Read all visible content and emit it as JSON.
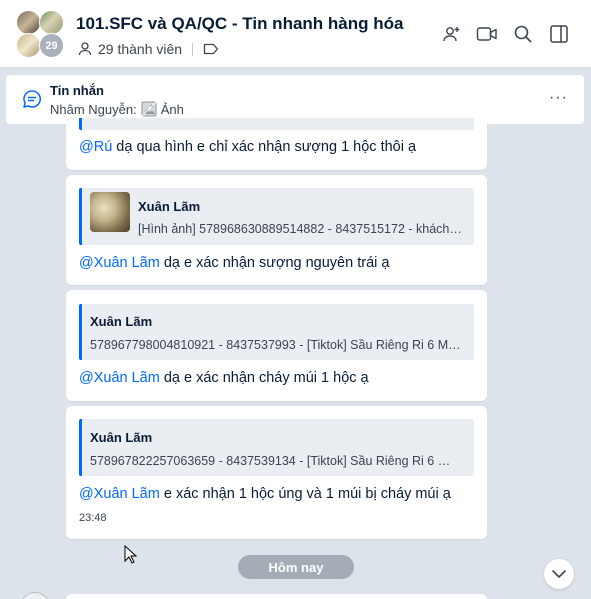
{
  "header": {
    "title": "101.SFC và QA/QC - Tin nhanh hàng hóa",
    "members": "29 thành viên",
    "member_badge": "29",
    "icons": [
      "user-group-icon",
      "tag-icon",
      "add-member-icon",
      "video-call-icon",
      "search-icon",
      "sidebar-toggle-icon"
    ]
  },
  "pinned": {
    "title": "Tin nhắn",
    "sender": "Nhâm Nguyễn:",
    "content": "Ảnh",
    "more": "···"
  },
  "messages": [
    {
      "mention": "@Rú",
      "text": " dạ qua hình e chỉ xác nhận sượng 1 hộc thôi ạ"
    },
    {
      "quote_name": "Xuân Lãm",
      "quote_text": "[Hình ảnh] 578968630889514882 - 8437515172 - khách…",
      "mention": "@Xuân Lãm",
      "text": " dạ e xác nhận sượng nguyên trái ạ"
    },
    {
      "quote_name": "Xuân Lãm",
      "quote_text": "578967798004810921 - 8437537993 - [Tiktok] Sầu Riêng Ri 6 M…",
      "mention": "@Xuân Lãm",
      "text": " dạ e xác nhận cháy múi 1 hộc ạ"
    },
    {
      "quote_name": "Xuân Lãm",
      "quote_text": "578967822257063659 - 8437539134 - [Tiktok] Sầu Riêng Ri 6 …",
      "mention": "@Xuân Lãm",
      "text": " e xác nhận 1 hộc úng và 1 múi bị cháy múi ạ",
      "time": "23:48"
    }
  ],
  "divider": {
    "label": "Hôm nay"
  },
  "colors": {
    "accent": "#0068ff",
    "background": "#dde3ea",
    "quote_bg": "#eaedf1"
  }
}
